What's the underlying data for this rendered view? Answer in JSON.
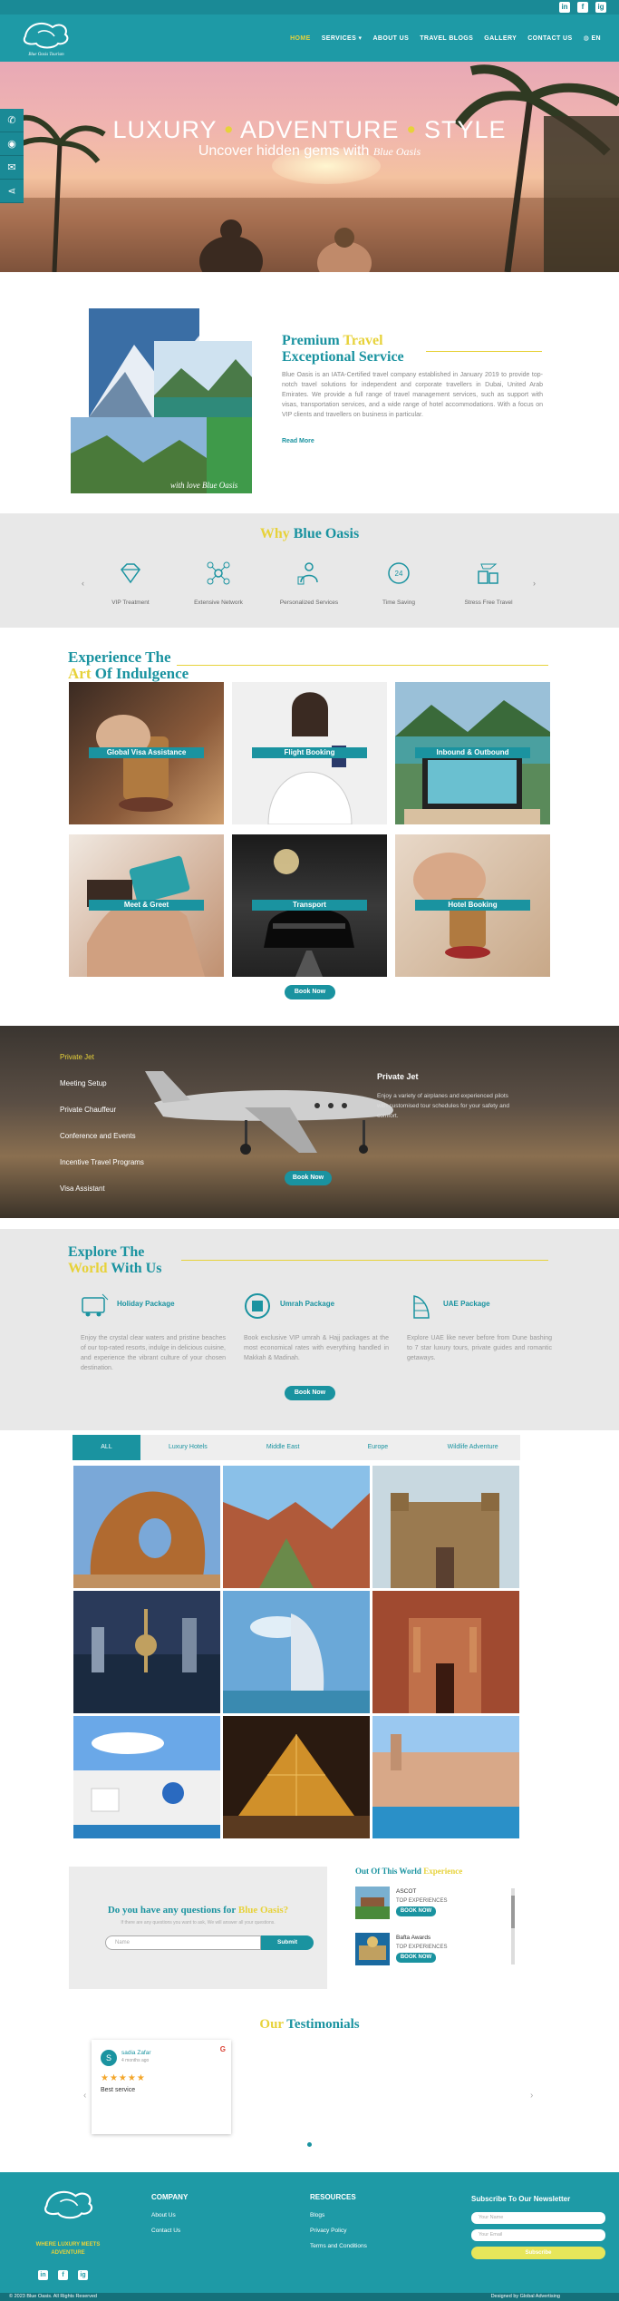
{
  "topbar": {
    "social": [
      "in",
      "f",
      "ig"
    ]
  },
  "header": {
    "logo_text": "Blue Oasis Tourism",
    "nav": [
      "HOME",
      "SERVICES",
      "ABOUT US",
      "TRAVEL BLOGS",
      "GALLERY",
      "CONTACT US",
      "EN"
    ]
  },
  "hero": {
    "word1": "LUXURY",
    "word2": "ADVENTURE",
    "word3": "STYLE",
    "subtitle": "Uncover hidden gems with",
    "subtitle_brand": "Blue Oasis",
    "side_buttons": [
      "phone-icon",
      "whatsapp-icon",
      "mail-icon",
      "share-icon"
    ]
  },
  "about": {
    "title_1": "Premium",
    "title_2": "Travel",
    "title_3": "Exceptional Service",
    "image_caption": "with love Blue Oasis",
    "text": "Blue Oasis is an IATA-Certified travel company established in January 2019 to provide top-notch travel solutions for independent and corporate travellers in Dubai, United Arab Emirates. We provide a full range of travel management services, such as support with visas, transportation services, and a wide range of hotel accommodations. With a focus on VIP clients and travellers on business in particular.",
    "read_more": "Read More"
  },
  "why": {
    "title_1": "Why",
    "title_2": "Blue Oasis",
    "items": [
      "VIP Treatment",
      "Extensive Network",
      "Personalized Services",
      "Time Saving",
      "Stress Free Travel"
    ],
    "time_saving_badge": "24"
  },
  "experience": {
    "title_1": "Experience",
    "title_2": "The",
    "title_3": "Art",
    "title_4": "Of",
    "title_5": "Indulgence",
    "cards": [
      "Global Visa Assistance",
      "Flight Booking",
      "Inbound & Outbound",
      "Meet & Greet",
      "Transport",
      "Hotel Booking"
    ],
    "book_now": "Book Now"
  },
  "jet": {
    "menu": [
      "Private Jet",
      "Meeting Setup",
      "Private Chauffeur",
      "Conference and Events",
      "Incentive Travel Programs",
      "Visa Assistant"
    ],
    "detail_title": "Private Jet",
    "detail_text": "Enjoy a variety of airplanes and experienced pilots with customised tour schedules for your safety and comfort.",
    "book_now": "Book Now"
  },
  "explore": {
    "title_1": "Explore",
    "title_2": "The",
    "title_3": "World",
    "title_4": "With Us",
    "packages": [
      {
        "name": "Holiday Package",
        "text": "Enjoy the crystal clear waters and pristine beaches of our top-rated resorts, indulge in delicious cuisine, and experience the vibrant culture of your chosen destination."
      },
      {
        "name": "Umrah Package",
        "text": "Book exclusive VIP umrah & Hajj packages at the most economical rates with everything handled in Makkah & Madinah."
      },
      {
        "name": "UAE Package",
        "text": "Explore UAE like never before from Dune bashing to 7 star luxury tours, private guides and romantic getaways."
      }
    ],
    "book_now": "Book Now"
  },
  "gallery": {
    "tabs": [
      "ALL",
      "Luxury Hotels",
      "Middle East",
      "Europe",
      "Wildlife Adventure"
    ]
  },
  "questions": {
    "title_1": "Do you have any questions for",
    "title_2": "Blue Oasis?",
    "subtitle": "If there are any questions you want to ask, We will answer all your questions.",
    "placeholder": "Name",
    "submit": "Submit"
  },
  "out_of_world": {
    "title_1": "Out Of This World",
    "title_2": "Experience",
    "items": [
      {
        "name": "ASCOT",
        "sub": "TOP EXPERIENCES",
        "btn": "BOOK NOW"
      },
      {
        "name": "Bafta Awards",
        "sub": "TOP EXPERIENCES",
        "btn": "BOOK NOW"
      }
    ]
  },
  "testimonials": {
    "title_1": "Our",
    "title_2": "Testimonials",
    "review": {
      "initial": "S",
      "name": "sadia Zafar",
      "time": "4 months ago",
      "stars": "★★★★★",
      "text": "Best service",
      "source": "G"
    }
  },
  "footer": {
    "tagline": "WHERE LUXURY MEETS ADVENTURE",
    "company_title": "COMPANY",
    "company_links": [
      "About Us",
      "Contact Us"
    ],
    "resources_title": "RESOURCES",
    "resources_links": [
      "Blogs",
      "Privacy Policy",
      "Terms and Conditions"
    ],
    "newsletter_title": "Subscribe To Our Newsletter",
    "name_placeholder": "Your Name",
    "email_placeholder": "Your Email",
    "subscribe": "Subscribe",
    "social": [
      "in",
      "f",
      "ig"
    ],
    "copyright": "© 2023 Blue Oasis. All Rights Reserved",
    "designed_by": "Designed by Global Advertising"
  },
  "colors": {
    "teal": "#1a93a0",
    "yellow": "#e7d23a",
    "header": "#1e9aa6"
  }
}
